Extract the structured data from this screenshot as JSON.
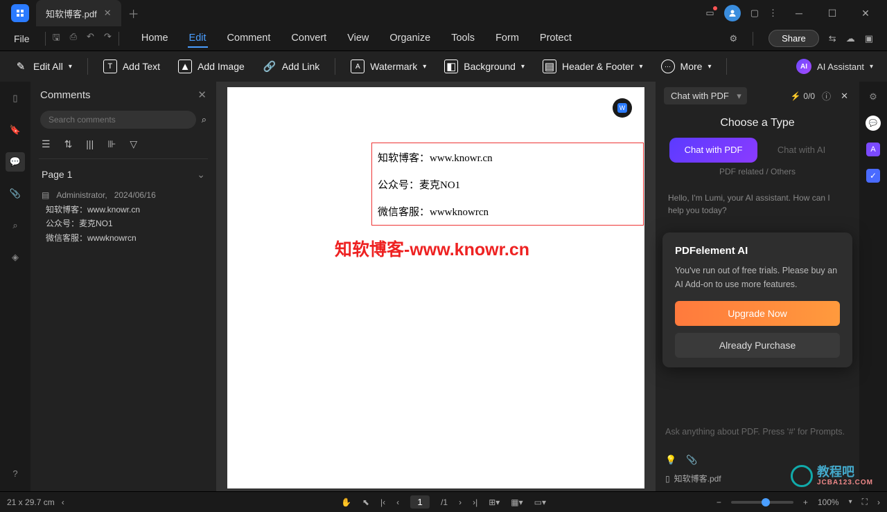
{
  "titlebar": {
    "tab_name": "知软博客.pdf"
  },
  "menu": {
    "file": "File",
    "items": [
      "Home",
      "Edit",
      "Comment",
      "Convert",
      "View",
      "Organize",
      "Tools",
      "Form",
      "Protect"
    ],
    "active_index": 1,
    "share": "Share"
  },
  "toolbar": {
    "edit_all": "Edit All",
    "add_text": "Add Text",
    "add_image": "Add Image",
    "add_link": "Add Link",
    "watermark": "Watermark",
    "background": "Background",
    "header_footer": "Header & Footer",
    "more": "More",
    "ai_assistant": "AI Assistant"
  },
  "comments": {
    "title": "Comments",
    "search_placeholder": "Search comments",
    "page_label": "Page 1",
    "author": "Administrator,",
    "date": "2024/06/16",
    "lines": [
      "知软博客：www.knowr.cn",
      "公众号：麦克NO1",
      "微信客服：wwwknowrcn"
    ]
  },
  "document": {
    "lines": [
      "知软博客：www.knowr.cn",
      "公众号：麦克NO1",
      "微信客服：wwwknowrcn"
    ],
    "watermark": "知软博客-www.knowr.cn"
  },
  "ai": {
    "selector": "Chat with PDF",
    "counter": "0/0",
    "title": "Choose a Type",
    "opt_active": "Chat with PDF",
    "opt_inactive": "Chat with AI",
    "sub": "PDF related / Others",
    "greeting": "Hello, I'm Lumi, your AI assistant. How can I help you today?",
    "popup_title": "PDFelement AI",
    "popup_body": "You've run out of free trials. Please buy an AI Add-on to use more features.",
    "upgrade": "Upgrade Now",
    "already": "Already Purchase",
    "input_placeholder": "Ask anything about PDF. Press '#' for Prompts.",
    "file": "知软博客.pdf"
  },
  "status": {
    "dims": "21 x 29.7 cm",
    "page_current": "1",
    "page_total": "/1",
    "zoom": "100%"
  },
  "footer": {
    "brand": "教程吧",
    "url": "JCBA123.COM"
  }
}
